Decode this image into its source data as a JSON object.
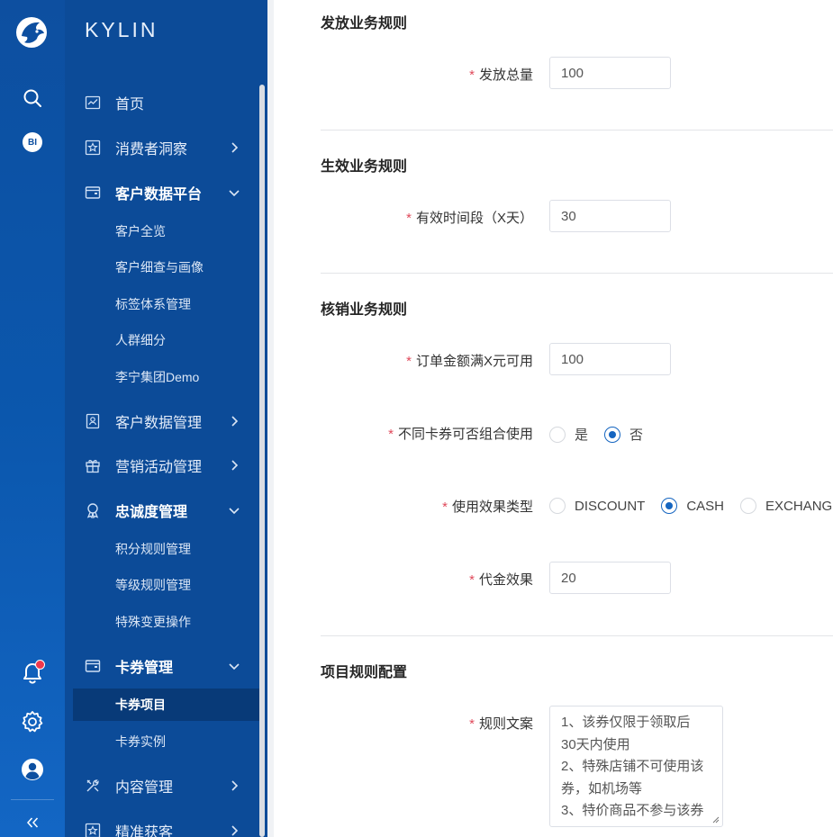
{
  "brand": "KYLIN",
  "rail": {
    "bi_label": "BI"
  },
  "menu": {
    "home": "首页",
    "consumer_insight": "消费者洞察",
    "cdp": "客户数据平台",
    "cdp_sub": [
      "客户全览",
      "客户细查与画像",
      "标签体系管理",
      "人群细分",
      "李宁集团Demo"
    ],
    "customer_data_mgmt": "客户数据管理",
    "marketing_mgmt": "营销活动管理",
    "loyalty_mgmt": "忠诚度管理",
    "loyalty_sub": [
      "积分规则管理",
      "等级规则管理",
      "特殊变更操作"
    ],
    "coupon_mgmt": "卡券管理",
    "coupon_sub": [
      "卡券项目",
      "卡券实例"
    ],
    "content_mgmt": "内容管理",
    "precise_acquire": "精准获客"
  },
  "form": {
    "section_issue": "发放业务规则",
    "issue_total_label": "发放总量",
    "issue_total_value": "100",
    "section_effective": "生效业务规则",
    "valid_period_label": "有效时间段（X天）",
    "valid_period_value": "30",
    "section_redeem": "核销业务规则",
    "min_order_label": "订单金额满X元可用",
    "min_order_value": "100",
    "combine_label": "不同卡券可否组合使用",
    "combine_yes": "是",
    "combine_no": "否",
    "effect_type_label": "使用效果类型",
    "effect_discount": "DISCOUNT",
    "effect_cash": "CASH",
    "effect_exchange": "EXCHANGE",
    "cash_effect_label": "代金效果",
    "cash_effect_value": "20",
    "section_project": "项目规则配置",
    "rule_text_label": "规则文案",
    "rule_text_lines": [
      "1、该券仅限于领取后",
      "30天内使用",
      "2、特殊店铺不可使用该",
      "券，如机场等",
      "3、特价商品不参与该券"
    ]
  }
}
